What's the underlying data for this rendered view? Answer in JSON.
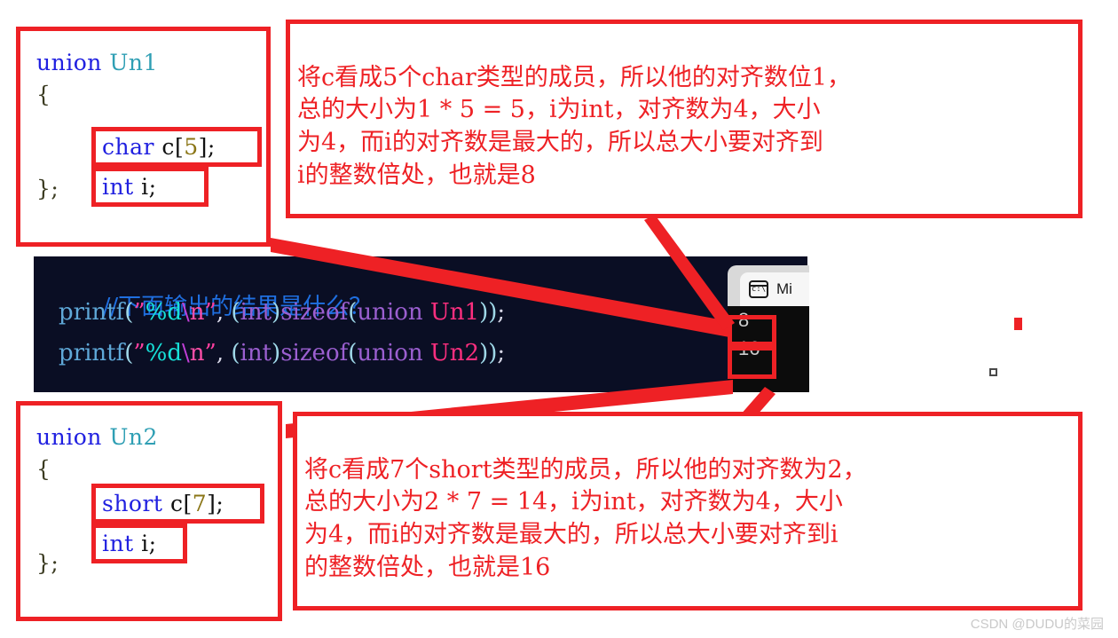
{
  "union1_box": {
    "title_kw": "union",
    "title_type": "Un1",
    "open_brace": "{",
    "member_array": "char c[5];",
    "member_int": "int i;",
    "close_brace": "};"
  },
  "union2_box": {
    "title_kw": "union",
    "title_type": "Un2",
    "open_brace": "{",
    "member_array": "short c[7];",
    "member_int": "int i;",
    "close_brace": "};"
  },
  "annotation_top": {
    "text": "将c看成5个char类型的成员，所以他的对齐数位1，\n总的大小为1 * 5 = 5，i为int，对齐数为4，大小\n为4，而i的对齐数是最大的，所以总大小要对齐到\ni的整数倍处，也就是8"
  },
  "annotation_bottom": {
    "text": "将c看成7个short类型的成员，所以他的对齐数为2，\n总的大小为2 * 7 = 14，i为int，对齐数为4，大小\n为4，而i的对齐数是最大的，所以总大小要对齐到i\n的整数倍处，也就是16"
  },
  "editor": {
    "comment_line": "//下面输出的结果是什么？",
    "line2": {
      "fn": "printf",
      "open_paren": "(",
      "quote_open": "”",
      "fmt": "%d",
      "esc_slash": "\\",
      "esc_n": "n",
      "quote_close": "”",
      "comma": ", ",
      "cast_open": "(",
      "cast_type": "int",
      "cast_close": ")",
      "sizeof": "sizeof",
      "sz_open": "(",
      "kw_union": "union",
      "type_name": "Un1",
      "sz_close": "))",
      "semi": ";"
    },
    "line3": {
      "fn": "printf",
      "open_paren": "(",
      "quote_open": "”",
      "fmt": "%d",
      "esc_slash": "\\",
      "esc_n": "n",
      "quote_close": "”",
      "comma": ", ",
      "cast_open": "(",
      "cast_type": "int",
      "cast_close": ")",
      "sizeof": "sizeof",
      "sz_open": "(",
      "kw_union": "union",
      "type_name": "Un2",
      "sz_close": "))",
      "semi": ";"
    }
  },
  "terminal": {
    "tab_icon": "console-icon",
    "tab_label": "Mi",
    "output_line1": "8",
    "output_line2": "16"
  },
  "watermark": {
    "text": "CSDN @DUDU的菜园"
  },
  "colors": {
    "annotation_red": "#ee2125",
    "editor_background": "#0a0e24",
    "terminal_background": "#0c0c0c",
    "keyword_blue": "#2020e0",
    "typename_teal": "#2f9fb4"
  }
}
